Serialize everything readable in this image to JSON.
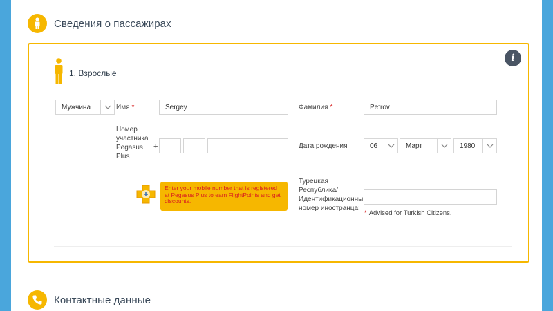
{
  "passengers_section": {
    "title": "Сведения о пассажирах"
  },
  "adult": {
    "heading": "1. Взрослые",
    "gender": {
      "selected": "Мужчина"
    },
    "first_name": {
      "label": "Имя",
      "required_mark": "*",
      "value": "Sergey"
    },
    "last_name": {
      "label": "Фамилия",
      "required_mark": "*",
      "value": "Petrov"
    },
    "pegasus_plus": {
      "label_lines": [
        "Номер",
        "участника",
        "Pegasus",
        "Plus"
      ],
      "plus_sign": "+",
      "field1": "",
      "field2": "",
      "field3": ""
    },
    "birth_date": {
      "label": "Дата рождения",
      "day": "06",
      "month": "Март",
      "year": "1980"
    },
    "tooltip": "Enter your mobile number that is registered at Pegasus Plus to earn FlightPoints and get discounts.",
    "national_id": {
      "label_lines": [
        "Турецкая",
        "Республика/",
        "Идентификационный",
        "номер иностранца:"
      ],
      "value": "",
      "advice_mark": "*",
      "advice": "Advised for Turkish Citizens."
    }
  },
  "contact_section": {
    "title": "Контактные данные"
  },
  "colors": {
    "accent": "#f6b700",
    "page_bg": "#4aa6dc",
    "required": "#d61c1c"
  },
  "icons": {
    "passenger": "person-icon",
    "adult": "person-icon",
    "info": "info-icon",
    "contact": "phone-icon",
    "pegasus_plus": "pegasus-plus-icon"
  }
}
